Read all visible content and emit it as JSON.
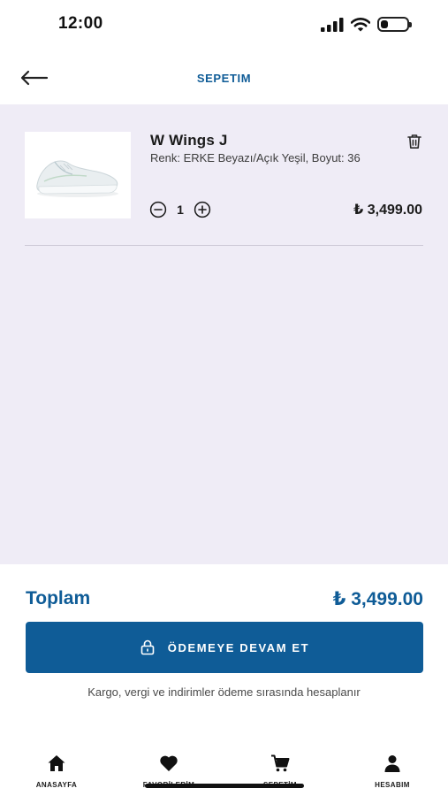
{
  "status_bar": {
    "time": "12:00",
    "icons": [
      "cellular-signal-icon",
      "wifi-icon",
      "battery-icon"
    ],
    "battery_level": 0.3
  },
  "header": {
    "back_icon": "arrow-left-icon",
    "title": "SEPETIM"
  },
  "cart": {
    "items": [
      {
        "name": "W Wings J",
        "variant": "Renk: ERKE Beyazı/Açık Yeşil, Boyut: 36",
        "quantity": "1",
        "price": "₺ 3,499.00",
        "image_icon": "sneaker-image",
        "delete_icon": "trash-icon",
        "decrement_icon": "minus-circle-icon",
        "increment_icon": "plus-circle-icon"
      }
    ]
  },
  "summary": {
    "total_label": "Toplam",
    "total_value": "₺ 3,499.00",
    "checkout_label": "ÖDEMEYE DEVAM ET",
    "checkout_icon": "lock-icon",
    "note": "Kargo, vergi ve indirimler ödeme sırasında hesaplanır"
  },
  "tab_bar": {
    "tabs": [
      {
        "label": "ANASAYFA",
        "icon": "home-icon"
      },
      {
        "label": "FAVORİLERİM",
        "icon": "heart-icon"
      },
      {
        "label": "SEPETİM",
        "icon": "cart-icon"
      },
      {
        "label": "HESABIM",
        "icon": "user-icon"
      }
    ]
  },
  "colors": {
    "brand": "#0f5c97",
    "content_background": "#efecf6",
    "text": "#1b1b1b"
  }
}
